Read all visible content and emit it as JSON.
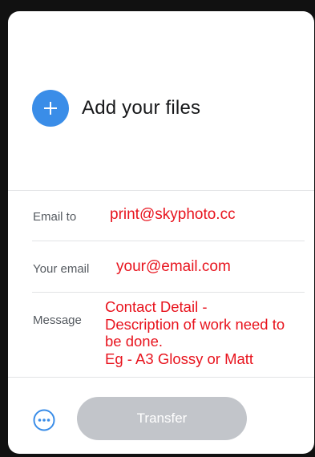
{
  "upload": {
    "add_files_label": "Add your files",
    "icon": "plus-icon",
    "accent_color": "#3a8de8"
  },
  "form": {
    "email_to": {
      "label": "Email to",
      "value": "print@skyphoto.cc"
    },
    "your_email": {
      "label": "Your email",
      "value": "your@email.com"
    },
    "message": {
      "label": "Message",
      "value": "Contact Detail -\nDescription of work need to be done.\nEg - A3 Glossy or Matt"
    },
    "value_color": "#e8141e"
  },
  "footer": {
    "more_icon": "more-options-icon",
    "transfer_label": "Transfer",
    "transfer_disabled": true
  }
}
